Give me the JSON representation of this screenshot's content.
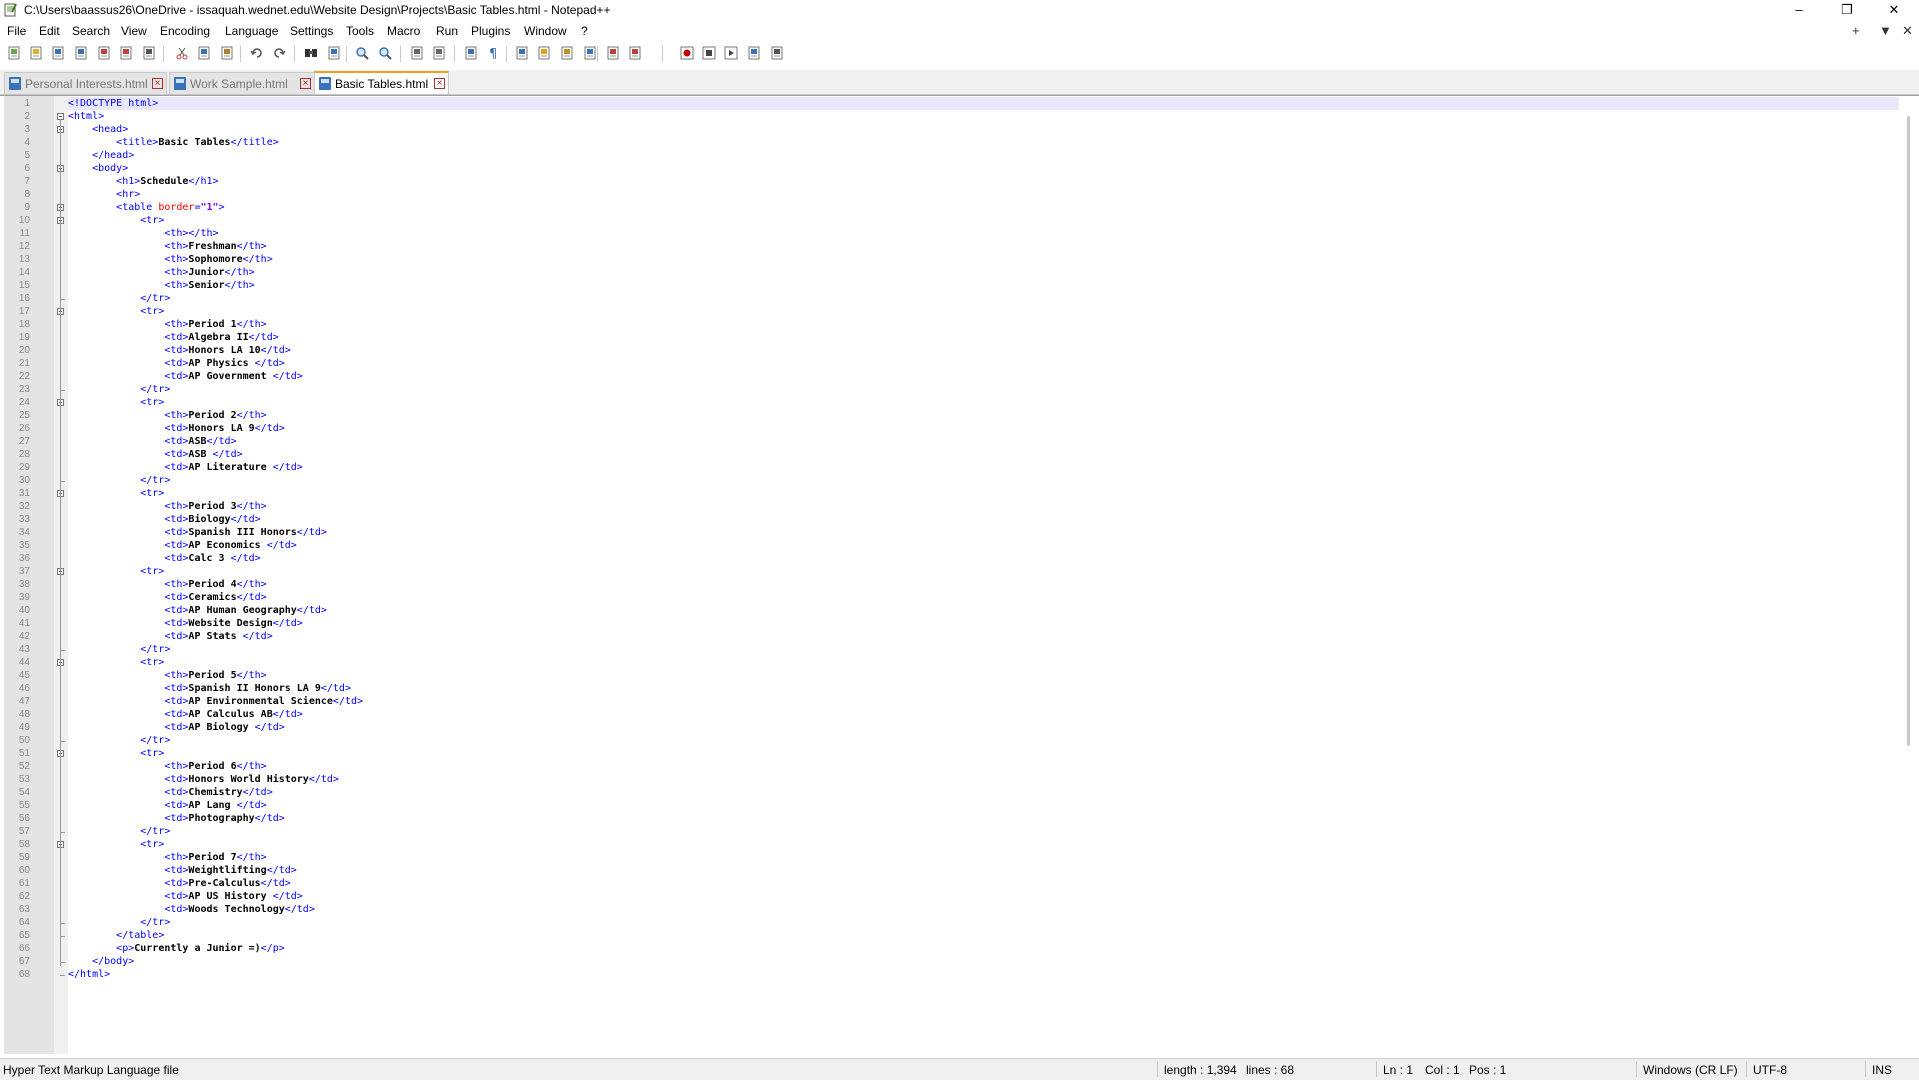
{
  "window": {
    "title": "C:\\Users\\baassus26\\OneDrive - issaquah.wednet.edu\\Website Design\\Projects\\Basic Tables.html - Notepad++",
    "minimize_glyph": "–",
    "maximize_glyph": "❐",
    "close_glyph": "✕"
  },
  "menu": {
    "items": [
      "File",
      "Edit",
      "Search",
      "View",
      "Encoding",
      "Language",
      "Settings",
      "Tools",
      "Macro",
      "Run",
      "Plugins",
      "Window",
      "?"
    ],
    "right_add": "+",
    "right_list": "▼",
    "right_close": "✕"
  },
  "toolbar": {
    "icons": [
      "new-file-icon",
      "open-file-icon",
      "save-icon",
      "save-all-icon",
      "close-icon",
      "close-all-icon",
      "print-icon",
      "cut-icon",
      "copy-icon",
      "paste-icon",
      "undo-icon",
      "redo-icon",
      "find-icon",
      "replace-icon",
      "zoom-in-icon",
      "zoom-out-icon",
      "sync-vertical-icon",
      "sync-horizontal-icon",
      "word-wrap-icon",
      "show-all-chars-icon",
      "indent-guide-icon",
      "user-language-icon",
      "document-map-icon",
      "function-list-icon",
      "folder-workspace-icon",
      "monitoring-icon",
      "record-macro-icon",
      "stop-record-icon",
      "play-macro-icon",
      "run-macro-multiple-icon",
      "save-macro-icon"
    ]
  },
  "tabs": [
    {
      "label": "Personal Interests.html",
      "active": false
    },
    {
      "label": "Work Sample.html",
      "active": false
    },
    {
      "label": "Basic Tables.html",
      "active": true
    }
  ],
  "editor": {
    "lines": [
      [
        [
          "t",
          "<!DOCTYPE html>"
        ]
      ],
      [
        [
          "t",
          "<html>"
        ]
      ],
      [
        [
          "s",
          "    "
        ],
        [
          "t",
          "<head>"
        ]
      ],
      [
        [
          "s",
          "        "
        ],
        [
          "t",
          "<title>"
        ],
        [
          "x",
          "Basic Tables"
        ],
        [
          "t",
          "</title>"
        ]
      ],
      [
        [
          "s",
          "    "
        ],
        [
          "t",
          "</head>"
        ]
      ],
      [
        [
          "s",
          "    "
        ],
        [
          "t",
          "<body>"
        ]
      ],
      [
        [
          "s",
          "        "
        ],
        [
          "t",
          "<h1>"
        ],
        [
          "x",
          "Schedule"
        ],
        [
          "t",
          "</h1>"
        ]
      ],
      [
        [
          "s",
          "        "
        ],
        [
          "t",
          "<hr>"
        ]
      ],
      [
        [
          "s",
          "        "
        ],
        [
          "t",
          "<table "
        ],
        [
          "a",
          "border"
        ],
        [
          "t",
          "="
        ],
        [
          "v",
          "\"1\""
        ],
        [
          "t",
          ">"
        ]
      ],
      [
        [
          "s",
          "            "
        ],
        [
          "t",
          "<tr>"
        ]
      ],
      [
        [
          "s",
          "                "
        ],
        [
          "t",
          "<th></th>"
        ]
      ],
      [
        [
          "s",
          "                "
        ],
        [
          "t",
          "<th>"
        ],
        [
          "x",
          "Freshman"
        ],
        [
          "t",
          "</th>"
        ]
      ],
      [
        [
          "s",
          "                "
        ],
        [
          "t",
          "<th>"
        ],
        [
          "x",
          "Sophomore"
        ],
        [
          "t",
          "</th>"
        ]
      ],
      [
        [
          "s",
          "                "
        ],
        [
          "t",
          "<th>"
        ],
        [
          "x",
          "Junior"
        ],
        [
          "t",
          "</th>"
        ]
      ],
      [
        [
          "s",
          "                "
        ],
        [
          "t",
          "<th>"
        ],
        [
          "x",
          "Senior"
        ],
        [
          "t",
          "</th>"
        ]
      ],
      [
        [
          "s",
          "            "
        ],
        [
          "t",
          "</tr>"
        ]
      ],
      [
        [
          "s",
          "            "
        ],
        [
          "t",
          "<tr>"
        ]
      ],
      [
        [
          "s",
          "                "
        ],
        [
          "t",
          "<th>"
        ],
        [
          "x",
          "Period 1"
        ],
        [
          "t",
          "</th>"
        ]
      ],
      [
        [
          "s",
          "                "
        ],
        [
          "t",
          "<td>"
        ],
        [
          "x",
          "Algebra II"
        ],
        [
          "t",
          "</td>"
        ]
      ],
      [
        [
          "s",
          "                "
        ],
        [
          "t",
          "<td>"
        ],
        [
          "x",
          "Honors LA 10"
        ],
        [
          "t",
          "</td>"
        ]
      ],
      [
        [
          "s",
          "                "
        ],
        [
          "t",
          "<td>"
        ],
        [
          "x",
          "AP Physics "
        ],
        [
          "t",
          "</td>"
        ]
      ],
      [
        [
          "s",
          "                "
        ],
        [
          "t",
          "<td>"
        ],
        [
          "x",
          "AP Government "
        ],
        [
          "t",
          "</td>"
        ]
      ],
      [
        [
          "s",
          "            "
        ],
        [
          "t",
          "</tr>"
        ]
      ],
      [
        [
          "s",
          "            "
        ],
        [
          "t",
          "<tr>"
        ]
      ],
      [
        [
          "s",
          "                "
        ],
        [
          "t",
          "<th>"
        ],
        [
          "x",
          "Period 2"
        ],
        [
          "t",
          "</th>"
        ]
      ],
      [
        [
          "s",
          "                "
        ],
        [
          "t",
          "<td>"
        ],
        [
          "x",
          "Honors LA 9"
        ],
        [
          "t",
          "</td>"
        ]
      ],
      [
        [
          "s",
          "                "
        ],
        [
          "t",
          "<td>"
        ],
        [
          "x",
          "ASB"
        ],
        [
          "t",
          "</td>"
        ]
      ],
      [
        [
          "s",
          "                "
        ],
        [
          "t",
          "<td>"
        ],
        [
          "x",
          "ASB "
        ],
        [
          "t",
          "</td>"
        ]
      ],
      [
        [
          "s",
          "                "
        ],
        [
          "t",
          "<td>"
        ],
        [
          "x",
          "AP Literature "
        ],
        [
          "t",
          "</td>"
        ]
      ],
      [
        [
          "s",
          "            "
        ],
        [
          "t",
          "</tr>"
        ]
      ],
      [
        [
          "s",
          "            "
        ],
        [
          "t",
          "<tr>"
        ]
      ],
      [
        [
          "s",
          "                "
        ],
        [
          "t",
          "<th>"
        ],
        [
          "x",
          "Period 3"
        ],
        [
          "t",
          "</th>"
        ]
      ],
      [
        [
          "s",
          "                "
        ],
        [
          "t",
          "<td>"
        ],
        [
          "x",
          "Biology"
        ],
        [
          "t",
          "</td>"
        ]
      ],
      [
        [
          "s",
          "                "
        ],
        [
          "t",
          "<td>"
        ],
        [
          "x",
          "Spanish III Honors"
        ],
        [
          "t",
          "</td>"
        ]
      ],
      [
        [
          "s",
          "                "
        ],
        [
          "t",
          "<td>"
        ],
        [
          "x",
          "AP Economics "
        ],
        [
          "t",
          "</td>"
        ]
      ],
      [
        [
          "s",
          "                "
        ],
        [
          "t",
          "<td>"
        ],
        [
          "x",
          "Calc 3 "
        ],
        [
          "t",
          "</td>"
        ]
      ],
      [
        [
          "s",
          "            "
        ],
        [
          "t",
          "<tr>"
        ]
      ],
      [
        [
          "s",
          "                "
        ],
        [
          "t",
          "<th>"
        ],
        [
          "x",
          "Period 4"
        ],
        [
          "t",
          "</th>"
        ]
      ],
      [
        [
          "s",
          "                "
        ],
        [
          "t",
          "<td>"
        ],
        [
          "x",
          "Ceramics"
        ],
        [
          "t",
          "</td>"
        ]
      ],
      [
        [
          "s",
          "                "
        ],
        [
          "t",
          "<td>"
        ],
        [
          "x",
          "AP Human Geography"
        ],
        [
          "t",
          "</td>"
        ]
      ],
      [
        [
          "s",
          "                "
        ],
        [
          "t",
          "<td>"
        ],
        [
          "x",
          "Website Design"
        ],
        [
          "t",
          "</td>"
        ]
      ],
      [
        [
          "s",
          "                "
        ],
        [
          "t",
          "<td>"
        ],
        [
          "x",
          "AP Stats "
        ],
        [
          "t",
          "</td>"
        ]
      ],
      [
        [
          "s",
          "            "
        ],
        [
          "t",
          "</tr>"
        ]
      ],
      [
        [
          "s",
          "            "
        ],
        [
          "t",
          "<tr>"
        ]
      ],
      [
        [
          "s",
          "                "
        ],
        [
          "t",
          "<th>"
        ],
        [
          "x",
          "Period 5"
        ],
        [
          "t",
          "</th>"
        ]
      ],
      [
        [
          "s",
          "                "
        ],
        [
          "t",
          "<td>"
        ],
        [
          "x",
          "Spanish II Honors LA 9"
        ],
        [
          "t",
          "</td>"
        ]
      ],
      [
        [
          "s",
          "                "
        ],
        [
          "t",
          "<td>"
        ],
        [
          "x",
          "AP Environmental Science"
        ],
        [
          "t",
          "</td>"
        ]
      ],
      [
        [
          "s",
          "                "
        ],
        [
          "t",
          "<td>"
        ],
        [
          "x",
          "AP Calculus AB"
        ],
        [
          "t",
          "</td>"
        ]
      ],
      [
        [
          "s",
          "                "
        ],
        [
          "t",
          "<td>"
        ],
        [
          "x",
          "AP Biology "
        ],
        [
          "t",
          "</td>"
        ]
      ],
      [
        [
          "s",
          "            "
        ],
        [
          "t",
          "</tr>"
        ]
      ],
      [
        [
          "s",
          "            "
        ],
        [
          "t",
          "<tr>"
        ]
      ],
      [
        [
          "s",
          "                "
        ],
        [
          "t",
          "<th>"
        ],
        [
          "x",
          "Period 6"
        ],
        [
          "t",
          "</th>"
        ]
      ],
      [
        [
          "s",
          "                "
        ],
        [
          "t",
          "<td>"
        ],
        [
          "x",
          "Honors World History"
        ],
        [
          "t",
          "</td>"
        ]
      ],
      [
        [
          "s",
          "                "
        ],
        [
          "t",
          "<td>"
        ],
        [
          "x",
          "Chemistry"
        ],
        [
          "t",
          "</td>"
        ]
      ],
      [
        [
          "s",
          "                "
        ],
        [
          "t",
          "<td>"
        ],
        [
          "x",
          "AP Lang "
        ],
        [
          "t",
          "</td>"
        ]
      ],
      [
        [
          "s",
          "                "
        ],
        [
          "t",
          "<td>"
        ],
        [
          "x",
          "Photography"
        ],
        [
          "t",
          "</td>"
        ]
      ],
      [
        [
          "s",
          "            "
        ],
        [
          "t",
          "</tr>"
        ]
      ],
      [
        [
          "s",
          "            "
        ],
        [
          "t",
          "<tr>"
        ]
      ],
      [
        [
          "s",
          "                "
        ],
        [
          "t",
          "<th>"
        ],
        [
          "x",
          "Period 7"
        ],
        [
          "t",
          "</th>"
        ]
      ],
      [
        [
          "s",
          "                "
        ],
        [
          "t",
          "<td>"
        ],
        [
          "x",
          "Weightlifting"
        ],
        [
          "t",
          "</td>"
        ]
      ],
      [
        [
          "s",
          "                "
        ],
        [
          "t",
          "<td>"
        ],
        [
          "x",
          "Pre-Calculus"
        ],
        [
          "t",
          "</td>"
        ]
      ],
      [
        [
          "s",
          "                "
        ],
        [
          "t",
          "<td>"
        ],
        [
          "x",
          "AP US History "
        ],
        [
          "t",
          "</td>"
        ]
      ],
      [
        [
          "s",
          "                "
        ],
        [
          "t",
          "<td>"
        ],
        [
          "x",
          "Woods Technology"
        ],
        [
          "t",
          "</td>"
        ]
      ],
      [
        [
          "s",
          "            "
        ],
        [
          "t",
          "</tr>"
        ]
      ],
      [
        [
          "s",
          "        "
        ],
        [
          "t",
          "</table>"
        ]
      ],
      [
        [
          "s",
          "        "
        ],
        [
          "t",
          "<p>"
        ],
        [
          "x",
          "Currently a Junior =)"
        ],
        [
          "t",
          "</p>"
        ]
      ],
      [
        [
          "s",
          "    "
        ],
        [
          "t",
          "</body>"
        ]
      ],
      [
        [
          "t",
          "</html>"
        ]
      ]
    ],
    "fold_open_lines": [
      2,
      3,
      6,
      9,
      10,
      17,
      24,
      31,
      37,
      44,
      51,
      58
    ],
    "fold_end_lines": [
      16,
      23,
      30,
      43,
      50,
      57,
      64,
      65,
      67,
      68
    ]
  },
  "status": {
    "file_type": "Hyper Text Markup Language file",
    "length": "length : 1,394",
    "lines": "lines : 68",
    "ln": "Ln : 1",
    "col": "Col : 1",
    "pos": "Pos : 1",
    "eol": "Windows (CR LF)",
    "encoding": "UTF-8",
    "mode": "INS"
  }
}
